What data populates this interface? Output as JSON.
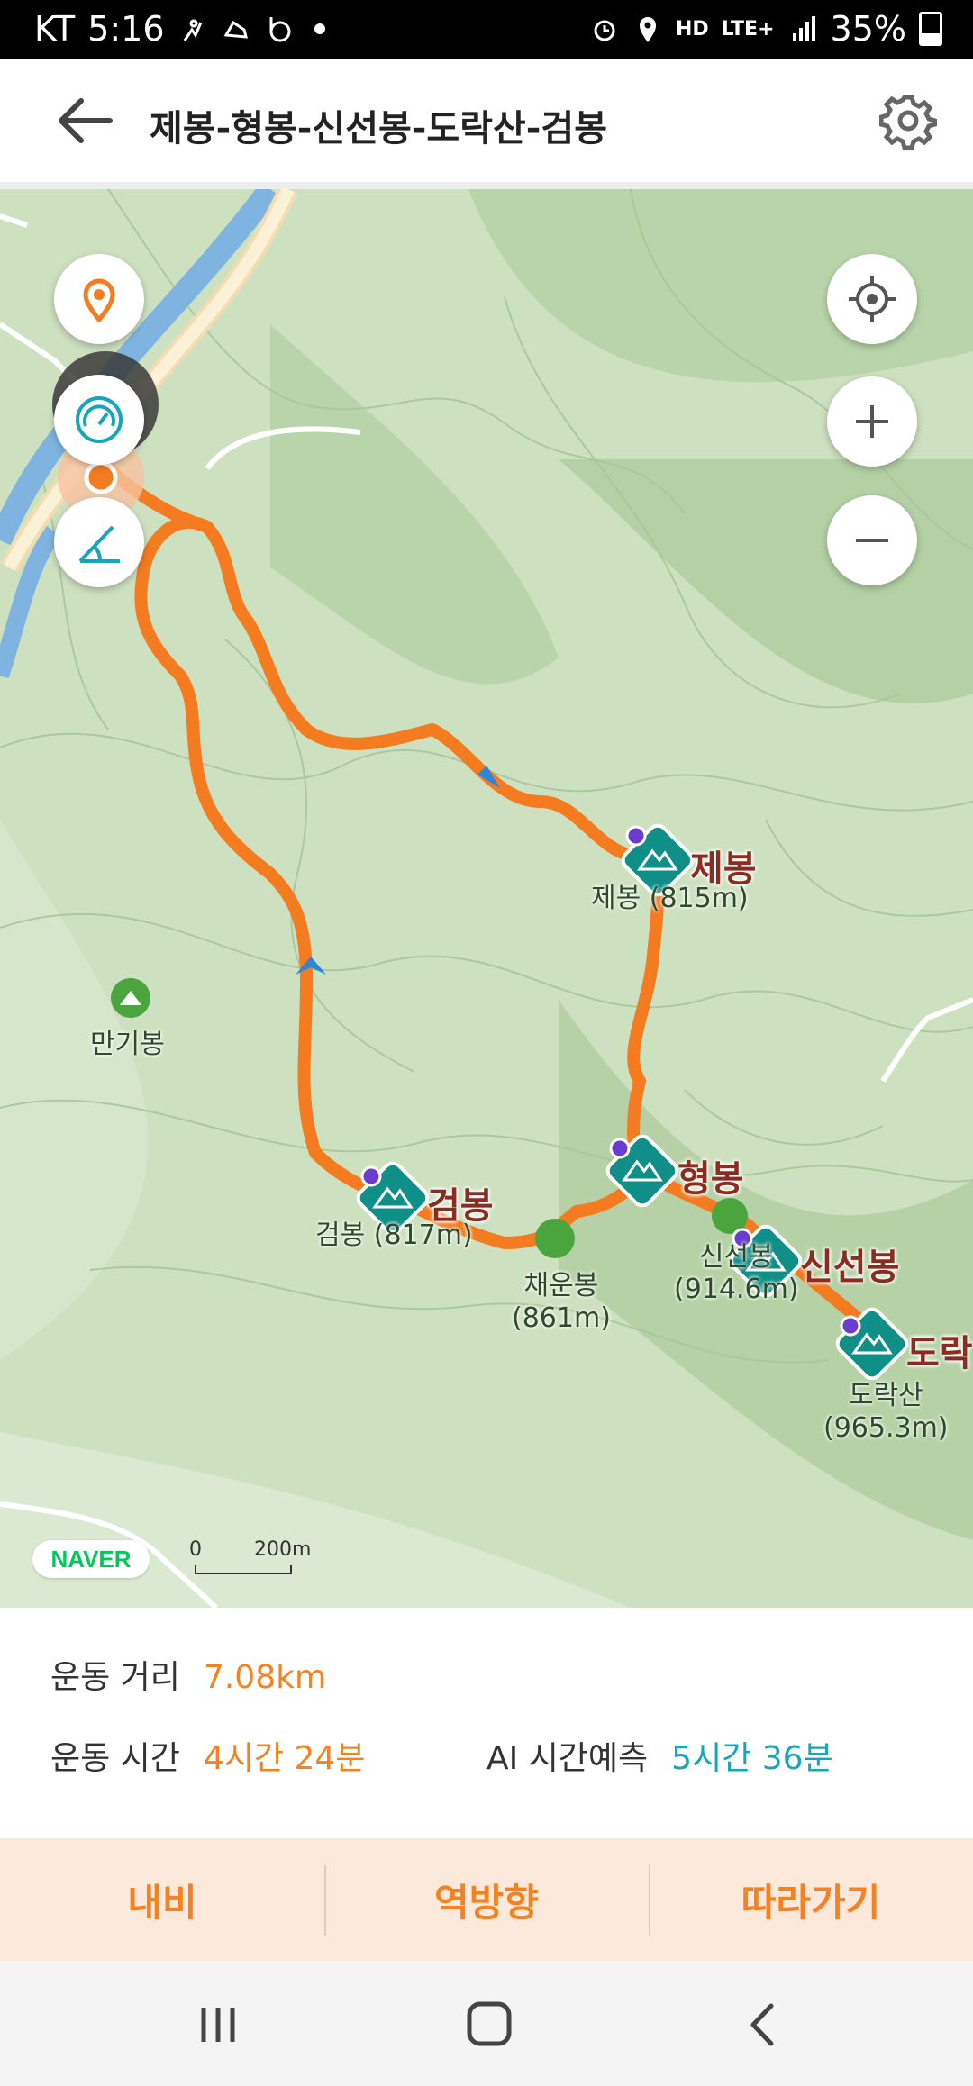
{
  "status_bar": {
    "carrier": "KT",
    "time": "5:16",
    "network": "LTE+",
    "hd": "HD",
    "battery": "35%"
  },
  "header": {
    "title": "제봉-형봉-신선봉-도락산-검봉",
    "back_icon": "arrow-left-icon",
    "settings_icon": "gear-icon"
  },
  "map": {
    "peaks": [
      {
        "name": "제봉",
        "label": "제봉 (815m)"
      },
      {
        "name": "형봉",
        "label": ""
      },
      {
        "name": "신선봉",
        "label": "신선봉\n(914.6m)"
      },
      {
        "name": "도락",
        "label": "도락산\n(965.3m)"
      },
      {
        "name": "검봉",
        "label": "검봉 (817m)"
      }
    ],
    "other_peaks": [
      {
        "label": "만기봉"
      },
      {
        "label_line1": "채운봉",
        "label_line2": "(861m)"
      }
    ],
    "peak_labels": {
      "jebong": "제봉 (815m)",
      "geombong": "검봉 (817m)",
      "sinseon_line1": "신선봉",
      "sinseon_line2": "(914.6m)",
      "dorak_line1": "도락산",
      "dorak_line2": "(965.3m)",
      "mangi": "만기봉",
      "chaeun_line1": "채운봉",
      "chaeun_line2": "(861m)"
    },
    "peak_titles": {
      "jebong": "제봉",
      "hyeongbong": "형봉",
      "sinseonbong": "신선봉",
      "dorak": "도락",
      "geombong": "검봉"
    },
    "brand": "NAVER",
    "scale_start": "0",
    "scale_end": "200m",
    "route_color": "#f47b20"
  },
  "stats": {
    "distance_label": "운동 거리",
    "distance_value": "7.08km",
    "time_label": "운동 시간",
    "time_value": "4시간 24분",
    "ai_label": "AI 시간예측",
    "ai_value": "5시간 36분"
  },
  "actions": {
    "navi": "내비",
    "reverse": "역방향",
    "follow": "따라가기"
  }
}
